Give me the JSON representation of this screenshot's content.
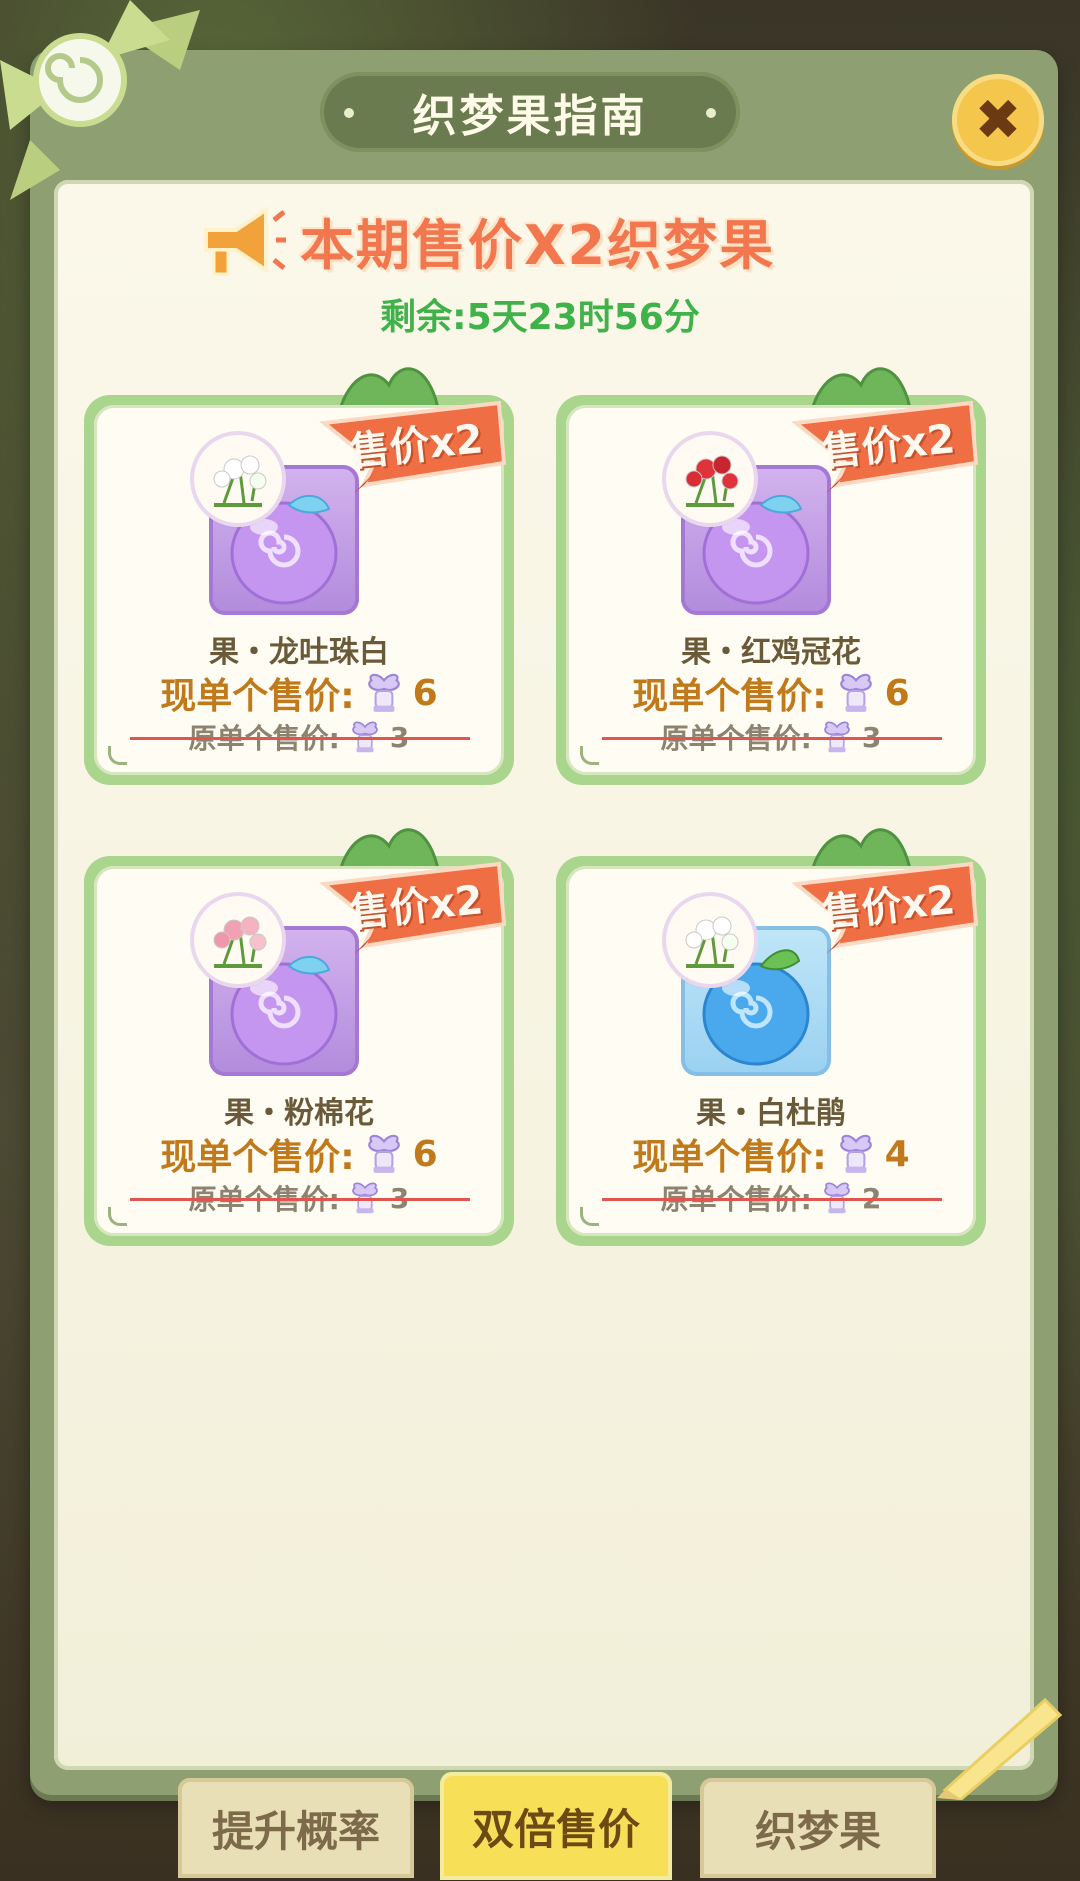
{
  "header": {
    "title": "织梦果指南",
    "close_label": "✖"
  },
  "promo": {
    "title": "本期售价X2织梦果",
    "countdown": "剩余:5天23时56分"
  },
  "cards": [
    {
      "badge": "售价x2",
      "name": "果・龙吐珠白",
      "now_label": "现单个售价:",
      "now_price": "6",
      "old_label": "原单个售价:",
      "old_price": "3",
      "fruit_color": "purple",
      "flower_icon": "white-flower-icon"
    },
    {
      "badge": "售价x2",
      "name": "果・红鸡冠花",
      "now_label": "现单个售价:",
      "now_price": "6",
      "old_label": "原单个售价:",
      "old_price": "3",
      "fruit_color": "purple",
      "flower_icon": "red-celosia-icon"
    },
    {
      "badge": "售价x2",
      "name": "果・粉棉花",
      "now_label": "现单个售价:",
      "now_price": "6",
      "old_label": "原单个售价:",
      "old_price": "3",
      "fruit_color": "purple",
      "flower_icon": "pink-flower-icon"
    },
    {
      "badge": "售价x2",
      "name": "果・白杜鹃",
      "now_label": "现单个售价:",
      "now_price": "4",
      "old_label": "原单个售价:",
      "old_price": "2",
      "fruit_color": "blue",
      "flower_icon": "white-azalea-icon"
    }
  ],
  "tabs": [
    {
      "label": "提升概率",
      "active": false
    },
    {
      "label": "双倍售价",
      "active": true
    },
    {
      "label": "织梦果",
      "active": false
    }
  ],
  "colors": {
    "accent_orange": "#f2774f",
    "countdown_green": "#3fb24a",
    "price_gold": "#c17a1b",
    "strike_red": "#e0564e"
  }
}
